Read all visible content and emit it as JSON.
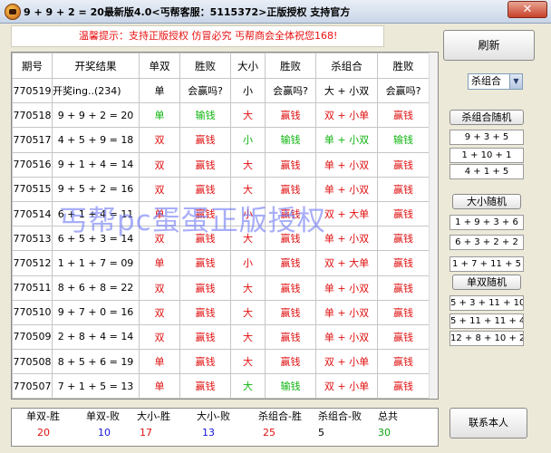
{
  "title": "9 + 9 + 2 = 20最新版4.0<丐帮客服：5115372>正版授权 支持官方",
  "close_label": "✕",
  "notice": "温馨提示：支持正版授权 仿冒必究 丐帮商会全体祝您168!",
  "columns": [
    "期号",
    "开奖结果",
    "单双",
    "胜败",
    "大小",
    "胜败",
    "杀组合",
    "胜败"
  ],
  "hint_row": {
    "period": "770519",
    "result": "开奖ing..(234)",
    "odd_even": "单",
    "odd_even_win": "会赢吗?",
    "big_small": "小",
    "big_small_win": "会赢吗?",
    "kill": "大 + 小双",
    "kill_win": "会赢吗?"
  },
  "rows": [
    {
      "period": "770518",
      "result": "9 + 9 + 2 = 20",
      "oe": "单",
      "oe_r": "输钱",
      "bs": "大",
      "bs_r": "赢钱",
      "kill": "双 + 小单",
      "kill_r": "赢钱"
    },
    {
      "period": "770517",
      "result": "4 + 5 + 9 = 18",
      "oe": "双",
      "oe_r": "赢钱",
      "bs": "小",
      "bs_r": "输钱",
      "kill": "单 + 小双",
      "kill_r": "输钱"
    },
    {
      "period": "770516",
      "result": "9 + 1 + 4 = 14",
      "oe": "双",
      "oe_r": "赢钱",
      "bs": "大",
      "bs_r": "赢钱",
      "kill": "单 + 小双",
      "kill_r": "赢钱"
    },
    {
      "period": "770515",
      "result": "9 + 5 + 2 = 16",
      "oe": "双",
      "oe_r": "赢钱",
      "bs": "大",
      "bs_r": "赢钱",
      "kill": "单 + 小双",
      "kill_r": "赢钱"
    },
    {
      "period": "770514",
      "result": "6 + 1 + 4 = 11",
      "oe": "单",
      "oe_r": "赢钱",
      "bs": "小",
      "bs_r": "赢钱",
      "kill": "双 + 大单",
      "kill_r": "赢钱"
    },
    {
      "period": "770513",
      "result": "6 + 5 + 3 = 14",
      "oe": "双",
      "oe_r": "赢钱",
      "bs": "大",
      "bs_r": "赢钱",
      "kill": "单 + 小双",
      "kill_r": "赢钱"
    },
    {
      "period": "770512",
      "result": "1 + 1 + 7 = 09",
      "oe": "单",
      "oe_r": "赢钱",
      "bs": "小",
      "bs_r": "赢钱",
      "kill": "双 + 大单",
      "kill_r": "赢钱"
    },
    {
      "period": "770511",
      "result": "8 + 6 + 8 = 22",
      "oe": "双",
      "oe_r": "赢钱",
      "bs": "大",
      "bs_r": "赢钱",
      "kill": "单 + 小双",
      "kill_r": "赢钱"
    },
    {
      "period": "770510",
      "result": "9 + 7 + 0 = 16",
      "oe": "双",
      "oe_r": "赢钱",
      "bs": "大",
      "bs_r": "赢钱",
      "kill": "单 + 小双",
      "kill_r": "赢钱"
    },
    {
      "period": "770509",
      "result": "2 + 8 + 4 = 14",
      "oe": "双",
      "oe_r": "赢钱",
      "bs": "大",
      "bs_r": "赢钱",
      "kill": "单 + 小双",
      "kill_r": "赢钱"
    },
    {
      "period": "770508",
      "result": "8 + 5 + 6 = 19",
      "oe": "单",
      "oe_r": "赢钱",
      "bs": "大",
      "bs_r": "赢钱",
      "kill": "双 + 小单",
      "kill_r": "赢钱"
    },
    {
      "period": "770507",
      "result": "7 + 1 + 5 = 13",
      "oe": "单",
      "oe_r": "赢钱",
      "bs": "大",
      "bs_r": "输钱",
      "kill": "双 + 小单",
      "kill_r": "赢钱"
    }
  ],
  "watermark": "丐帮pc蛋蛋正版授权",
  "stats": [
    {
      "label": "单双-胜",
      "value": "20",
      "color": "#e01010"
    },
    {
      "label": "单双-败",
      "value": "10",
      "color": "#1515d8"
    },
    {
      "label": "大小-胜",
      "value": "17",
      "color": "#e01010"
    },
    {
      "label": "大小-败",
      "value": "13",
      "color": "#1515d8"
    },
    {
      "label": "杀组合-胜",
      "value": "25",
      "color": "#e01010"
    },
    {
      "label": "杀组合-败",
      "value": "5",
      "color": "#000000"
    },
    {
      "label": "总共",
      "value": "30",
      "color": "#10a010"
    }
  ],
  "sidebar": {
    "refresh_label": "刷新",
    "combo_value": "杀组合",
    "kill_random_label": "杀组合随机",
    "kill_random": [
      "9 + 3 + 5",
      "1 + 10 + 1",
      "4 + 1 + 5"
    ],
    "bigsmall_random_label": "大小随机",
    "bigsmall_random": [
      "1 + 9 + 3 + 6",
      "6 + 3 + 2 + 2",
      "1 + 7 + 11 + 5"
    ],
    "oddeven_random_label": "单双随机",
    "oddeven_random": [
      "5 + 3 + 11 + 10",
      "5 + 11 + 11 + 4",
      "12 + 8 + 10 + 2"
    ],
    "contact_label": "联系本人"
  },
  "colors": {
    "win": "#e01010",
    "lose": "#10b410",
    "title_bg": "#c9d6e8",
    "watermark": "#6e78f5"
  }
}
